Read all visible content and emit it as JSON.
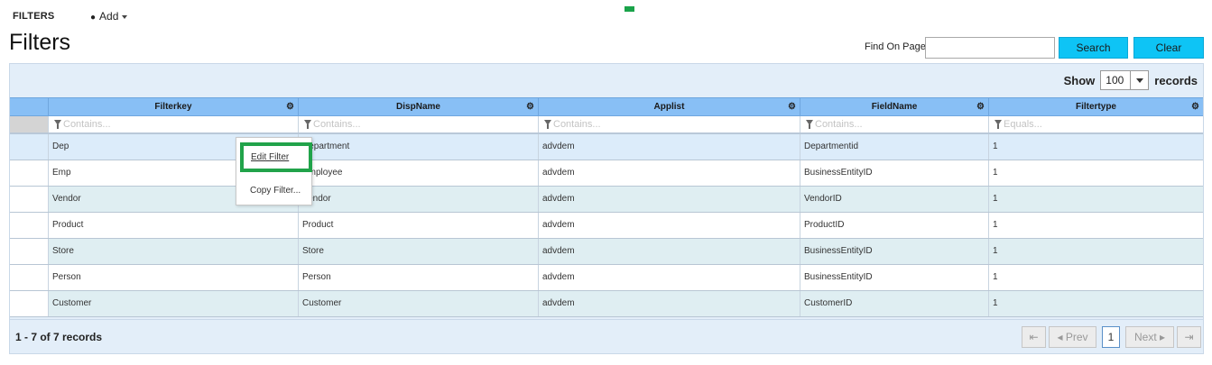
{
  "topbar": {
    "section": "FILTERS",
    "add_label": "Add"
  },
  "page": {
    "title": "Filters"
  },
  "find": {
    "label": "Find On Page",
    "value": "",
    "search_label": "Search",
    "clear_label": "Clear"
  },
  "paging": {
    "show_label": "Show",
    "page_size": "100",
    "records_label": "records"
  },
  "grid": {
    "columns": [
      {
        "label": "Filterkey",
        "placeholder": "Contains..."
      },
      {
        "label": "DispName",
        "placeholder": "Contains..."
      },
      {
        "label": "Applist",
        "placeholder": "Contains..."
      },
      {
        "label": "FieldName",
        "placeholder": "Contains..."
      },
      {
        "label": "Filtertype",
        "placeholder": "Equals..."
      }
    ],
    "rows": [
      [
        "Dep",
        "Department",
        "advdem",
        "Departmentid",
        "1"
      ],
      [
        "Emp",
        "Employee",
        "advdem",
        "BusinessEntityID",
        "1"
      ],
      [
        "Vendor",
        "Vendor",
        "advdem",
        "VendorID",
        "1"
      ],
      [
        "Product",
        "Product",
        "advdem",
        "ProductID",
        "1"
      ],
      [
        "Store",
        "Store",
        "advdem",
        "BusinessEntityID",
        "1"
      ],
      [
        "Person",
        "Person",
        "advdem",
        "BusinessEntityID",
        "1"
      ],
      [
        "Customer",
        "Customer",
        "advdem",
        "CustomerID",
        "1"
      ]
    ]
  },
  "footer": {
    "record_count": "1 - 7 of 7 records",
    "first_label": "⇤",
    "prev_label": "◂ Prev",
    "current_page": "1",
    "next_label": "Next ▸",
    "last_label": "⇥"
  },
  "context_menu": {
    "edit_label": "Edit Filter",
    "copy_label": "Copy Filter..."
  },
  "colors": {
    "header": "#88bff5",
    "accent_button": "#0ec4f5",
    "highlight": "#21a34a",
    "row_alt": "#dfeef2"
  },
  "icons": {
    "column_menu": "gear-icon",
    "filter": "funnel-icon",
    "dropdown": "caret-down-icon"
  }
}
